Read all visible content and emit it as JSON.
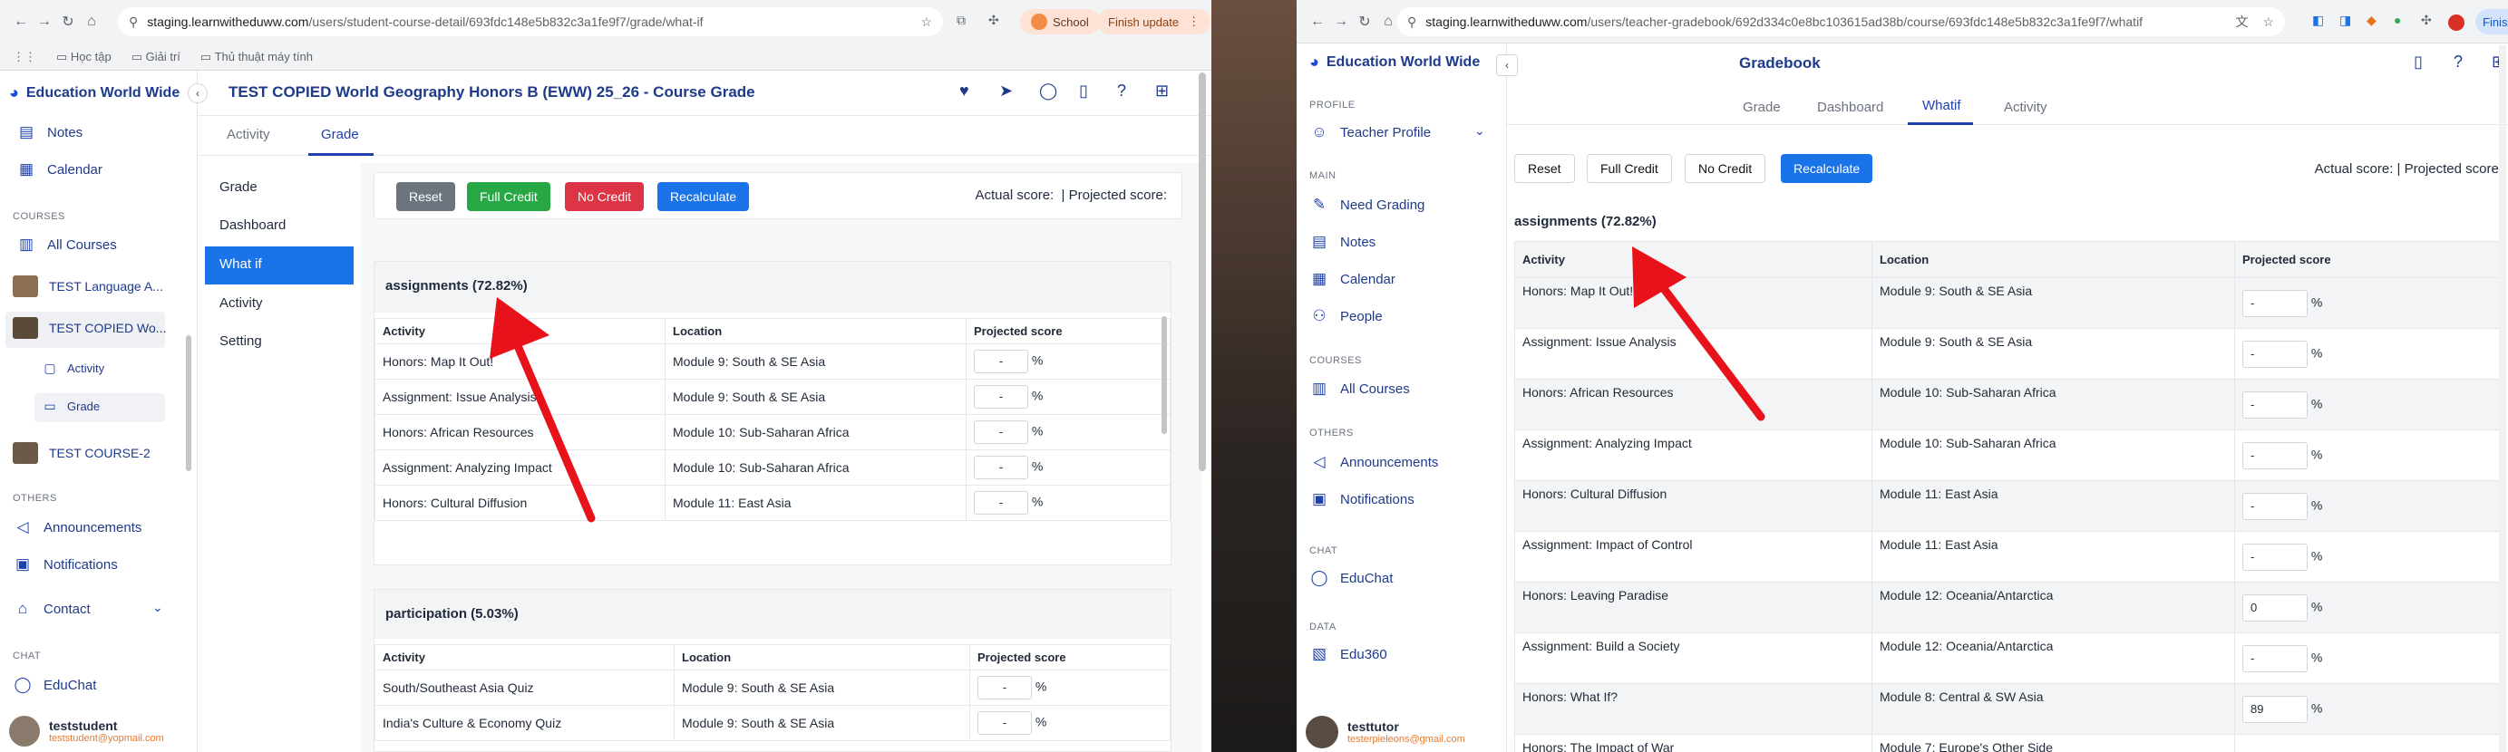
{
  "left": {
    "url_host": "staging.learnwitheduww.com",
    "url_path": "/users/student-course-detail/693fdc148e5b832c3a1fe9f7/grade/what-if",
    "school_label": "School",
    "finish_update": "Finish update",
    "bookmarks": [
      "Học tập",
      "Giải trí",
      "Thủ thuật máy tính"
    ],
    "brand": "Education World Wide",
    "page_title": "TEST COPIED World Geography Honors B (EWW) 25_26 - Course Grade",
    "tabs": [
      "Activity",
      "Grade"
    ],
    "nav": {
      "notes": "Notes",
      "calendar": "Calendar",
      "courses_title": "COURSES",
      "all_courses": "All Courses",
      "course1": "TEST Language A...",
      "course2": "TEST COPIED Wo...",
      "sub_activity": "Activity",
      "sub_grade": "Grade",
      "course3": "TEST COURSE-2",
      "others_title": "OTHERS",
      "announcements": "Announcements",
      "notifications": "Notifications",
      "contact": "Contact",
      "chat_title": "CHAT",
      "educhat": "EduChat",
      "user_name": "teststudent",
      "user_email": "teststudent@yopmail.com"
    },
    "submenu": [
      "Grade",
      "Dashboard",
      "What if",
      "Activity",
      "Setting"
    ],
    "buttons": {
      "reset": "Reset",
      "full_credit": "Full Credit",
      "no_credit": "No Credit",
      "recalculate": "Recalculate"
    },
    "score_text": "Actual score:  | Projected score:",
    "assignments_title": "assignments (72.82%)",
    "columns": [
      "Activity",
      "Location",
      "Projected score"
    ],
    "rows": [
      {
        "activity": "Honors: Map It Out!",
        "location": "Module 9: South & SE Asia",
        "score": "-"
      },
      {
        "activity": "Assignment: Issue Analysis",
        "location": "Module 9: South & SE Asia",
        "score": "-"
      },
      {
        "activity": "Honors: African Resources",
        "location": "Module 10: Sub-Saharan Africa",
        "score": "-"
      },
      {
        "activity": "Assignment: Analyzing Impact",
        "location": "Module 10: Sub-Saharan Africa",
        "score": "-"
      },
      {
        "activity": "Honors: Cultural Diffusion",
        "location": "Module 11: East Asia",
        "score": "-"
      }
    ],
    "participation_title": "participation (5.03%)",
    "prows": [
      {
        "activity": "South/Southeast Asia Quiz",
        "location": "Module 9: South & SE Asia",
        "score": "-"
      },
      {
        "activity": "India's Culture & Economy Quiz",
        "location": "Module 9: South & SE Asia",
        "score": "-"
      }
    ],
    "percent": "%"
  },
  "right": {
    "url_host": "staging.learnwitheduww.com",
    "url_path": "/users/teacher-gradebook/692d334c0e8bc103615ad38b/course/693fdc148e5b832c3a1fe9f7/whatif",
    "finish_update": "Finish update",
    "brand": "Education World Wide",
    "page_title": "Gradebook",
    "tabs": [
      "Grade",
      "Dashboard",
      "Whatif",
      "Activity"
    ],
    "nav": {
      "profile_title": "PROFILE",
      "teacher_profile": "Teacher Profile",
      "main_title": "MAIN",
      "need_grading": "Need Grading",
      "notes": "Notes",
      "calendar": "Calendar",
      "people": "People",
      "courses_title": "COURSES",
      "all_courses": "All Courses",
      "others_title": "OTHERS",
      "announcements": "Announcements",
      "notifications": "Notifications",
      "chat_title": "CHAT",
      "educhat": "EduChat",
      "data_title": "DATA",
      "edu360": "Edu360",
      "user_name": "testtutor",
      "user_email": "testerpieleons@gmail.com"
    },
    "buttons": {
      "reset": "Reset",
      "full_credit": "Full Credit",
      "no_credit": "No Credit",
      "recalculate": "Recalculate"
    },
    "score_text": "Actual score: | Projected score:",
    "assignments_title": "assignments (72.82%)",
    "columns": [
      "Activity",
      "Location",
      "Projected score"
    ],
    "rows": [
      {
        "activity": "Honors: Map It Out!",
        "location": "Module 9: South & SE Asia",
        "score": "-"
      },
      {
        "activity": "Assignment: Issue Analysis",
        "location": "Module 9: South & SE Asia",
        "score": "-"
      },
      {
        "activity": "Honors: African Resources",
        "location": "Module 10: Sub-Saharan Africa",
        "score": "-"
      },
      {
        "activity": "Assignment: Analyzing Impact",
        "location": "Module 10: Sub-Saharan Africa",
        "score": "-"
      },
      {
        "activity": "Honors: Cultural Diffusion",
        "location": "Module 11: East Asia",
        "score": "-"
      },
      {
        "activity": "Assignment: Impact of Control",
        "location": "Module 11: East Asia",
        "score": "-"
      },
      {
        "activity": "Honors: Leaving Paradise",
        "location": "Module 12: Oceania/Antarctica",
        "score": "0"
      },
      {
        "activity": "Assignment: Build a Society",
        "location": "Module 12: Oceania/Antarctica",
        "score": "-"
      },
      {
        "activity": "Honors: What If?",
        "location": "Module 8: Central & SW Asia",
        "score": "89"
      },
      {
        "activity": "Honors: The Impact of War",
        "location": "Module 7: Europe's Other Side",
        "score": ""
      }
    ],
    "percent": "%"
  },
  "colors": {
    "accent": "#1a73e8",
    "brand": "#1e3a8a",
    "red_arrow": "#e8121b",
    "green": "#28a745",
    "red": "#dc3545",
    "gray": "#6c757d"
  }
}
